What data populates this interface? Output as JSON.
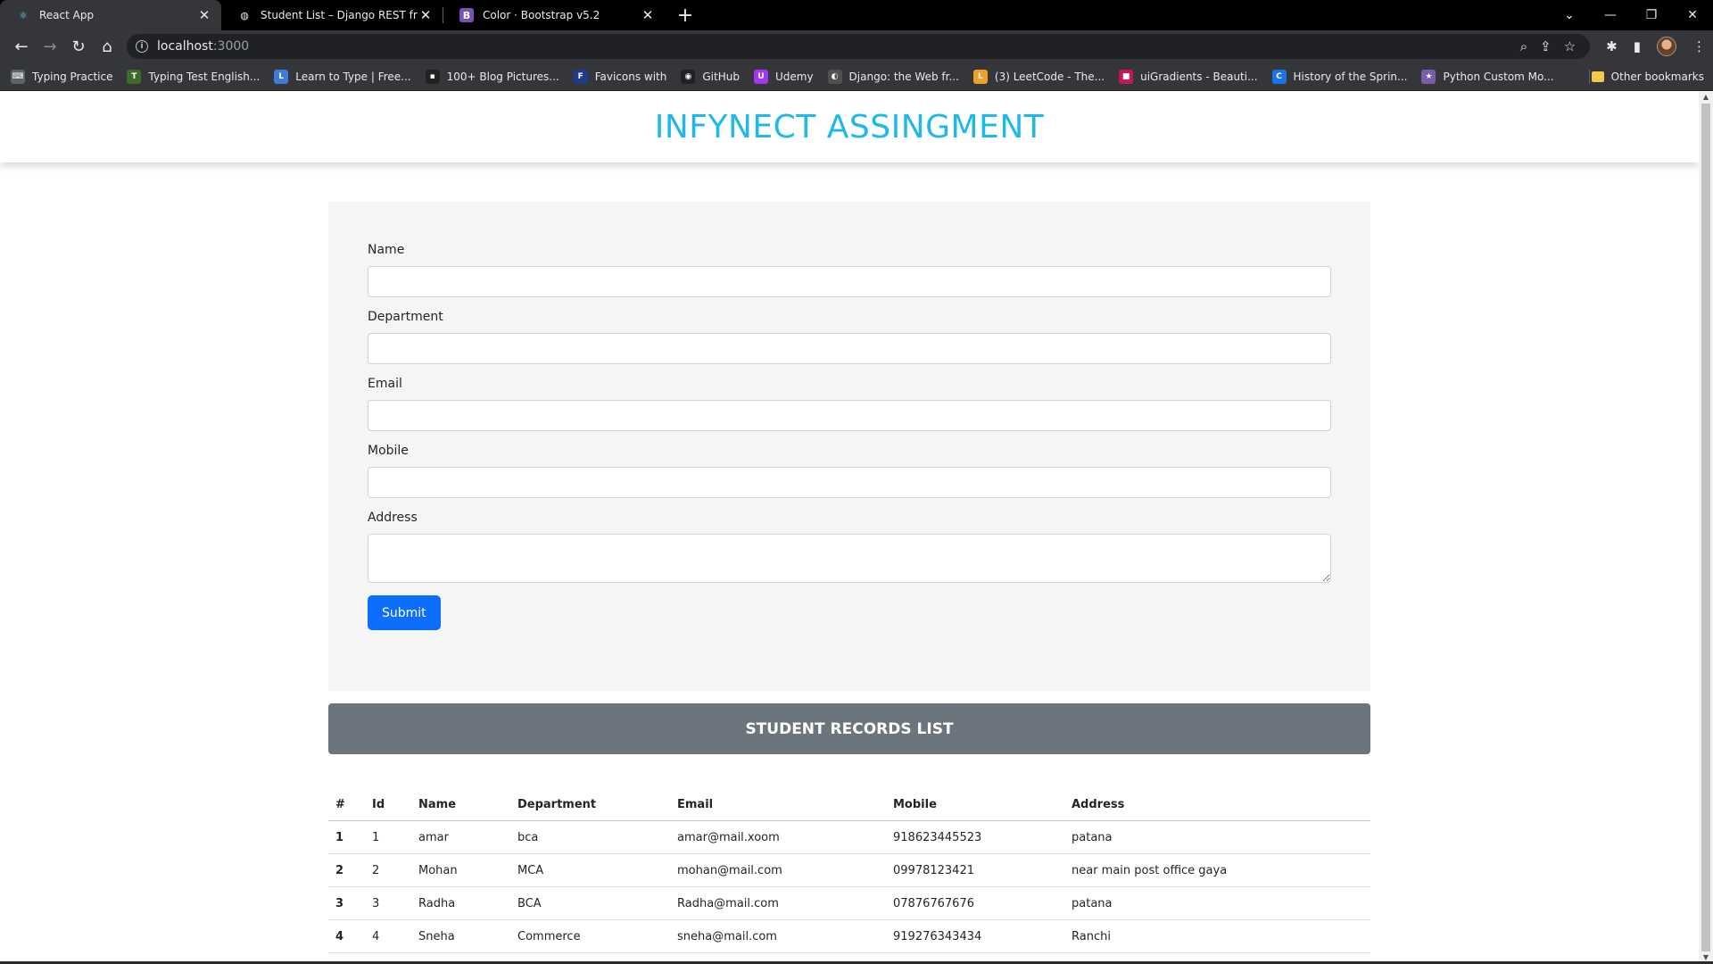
{
  "browser": {
    "tabs": [
      {
        "title": "React App",
        "icon": "react-icon",
        "active": true
      },
      {
        "title": "Student List – Django REST frame",
        "icon": "globe-icon",
        "active": false
      },
      {
        "title": "Color · Bootstrap v5.2",
        "icon": "bootstrap-icon",
        "active": false
      }
    ],
    "url_host": "localhost",
    "url_port": ":3000",
    "bookmarks": [
      {
        "label": "Typing Practice",
        "color": "#5f6368",
        "glyph": "⌨"
      },
      {
        "label": "Typing Test English...",
        "color": "#3d6b2a",
        "glyph": "T"
      },
      {
        "label": "Learn to Type | Free...",
        "color": "#3f7bd9",
        "glyph": "L"
      },
      {
        "label": "100+ Blog Pictures...",
        "color": "#222222",
        "glyph": "▪"
      },
      {
        "label": "Favicons with",
        "color": "#1e3a8a",
        "glyph": "F"
      },
      {
        "label": "GitHub",
        "color": "#202124",
        "glyph": "◉"
      },
      {
        "label": "Udemy",
        "color": "#a435f0",
        "glyph": "U"
      },
      {
        "label": "Django: the Web fr...",
        "color": "#505050",
        "glyph": "◐"
      },
      {
        "label": "(3) LeetCode - The...",
        "color": "#f0a02a",
        "glyph": "L"
      },
      {
        "label": "uiGradients - Beauti...",
        "color": "#c2185b",
        "glyph": "■"
      },
      {
        "label": "History of the Sprin...",
        "color": "#1a73e8",
        "glyph": "C"
      },
      {
        "label": "Python Custom Mo...",
        "color": "#7b5ea7",
        "glyph": "★"
      }
    ],
    "other_bookmarks": "Other bookmarks"
  },
  "page": {
    "title": "INFYNECT ASSINGMENT",
    "form": {
      "fields": [
        {
          "label": "Name",
          "value": ""
        },
        {
          "label": "Department",
          "value": ""
        },
        {
          "label": "Email",
          "value": ""
        },
        {
          "label": "Mobile",
          "value": ""
        },
        {
          "label": "Address",
          "value": ""
        }
      ],
      "submit_label": "Submit"
    },
    "records_title": "STUDENT RECORDS LIST",
    "table": {
      "headers": [
        "#",
        "Id",
        "Name",
        "Department",
        "Email",
        "Mobile",
        "Address"
      ],
      "rows": [
        [
          "1",
          "1",
          "amar",
          "bca",
          "amar@mail.xoom",
          "918623445523",
          "patana"
        ],
        [
          "2",
          "2",
          "Mohan",
          "MCA",
          "mohan@mail.com",
          "09978123421",
          "near main post office gaya"
        ],
        [
          "3",
          "3",
          "Radha",
          "BCA",
          "Radha@mail.com",
          "07876767676",
          "patana"
        ],
        [
          "4",
          "4",
          "Sneha",
          "Commerce",
          "sneha@mail.com",
          "919276343434",
          "Ranchi"
        ]
      ]
    }
  },
  "colors": {
    "title": "#1fb9e8",
    "submit": "#0d6efd",
    "banner": "#6c757d"
  }
}
